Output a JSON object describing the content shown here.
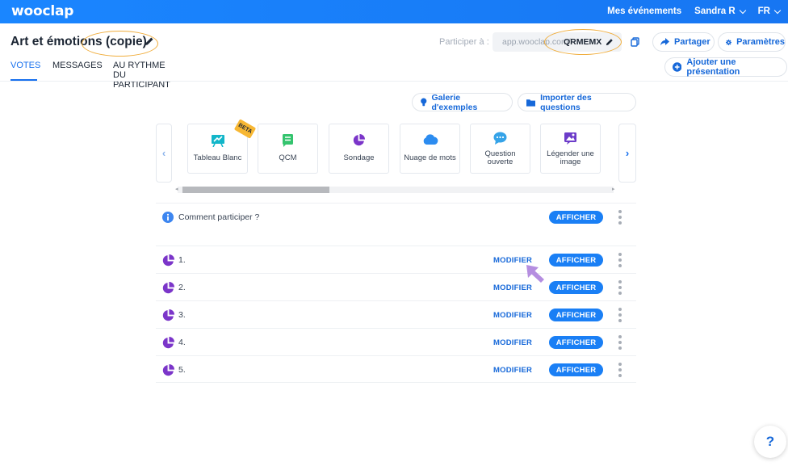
{
  "app": {
    "brand": "wooclap"
  },
  "topnav": {
    "events": "Mes événements",
    "user": "Sandra R",
    "lang": "FR"
  },
  "event": {
    "title": "Art et émotions (copie)"
  },
  "participate": {
    "label": "Participer à :",
    "url_base": "app.wooclap.com/",
    "code": "QRMEMX"
  },
  "actions": {
    "share": "Partager",
    "settings": "Paramètres",
    "add_presentation": "Ajouter une présentation"
  },
  "tabs": [
    {
      "label": "VOTES",
      "active": true
    },
    {
      "label": "MESSAGES",
      "active": false
    },
    {
      "label": "AU RYTHME DU PARTICIPANT",
      "active": false
    }
  ],
  "library": {
    "gallery": "Galerie d'exemples",
    "import": "Importer des questions"
  },
  "question_types": [
    {
      "label": "Tableau Blanc",
      "icon": "whiteboard-icon",
      "color": "#12b6c9"
    },
    {
      "label": "QCM",
      "icon": "mcq-icon",
      "color": "#34c46e"
    },
    {
      "label": "Sondage",
      "icon": "poll-icon",
      "color": "#7b35c9"
    },
    {
      "label": "Nuage de mots",
      "icon": "cloud-icon",
      "color": "#2c8cf0"
    },
    {
      "label": "Question ouverte",
      "icon": "chat-bubble-icon",
      "color": "#35a3e8"
    },
    {
      "label": "Légender une image",
      "icon": "image-label-icon",
      "color": "#6c3cc9"
    }
  ],
  "beta_badge": "BETA",
  "how_to": {
    "label": "Comment participer ?",
    "show": "AFFICHER"
  },
  "questions": [
    {
      "label": "1.",
      "edit": "MODIFIER",
      "show": "AFFICHER"
    },
    {
      "label": "2.",
      "edit": "MODIFIER",
      "show": "AFFICHER"
    },
    {
      "label": "3.",
      "edit": "MODIFIER",
      "show": "AFFICHER"
    },
    {
      "label": "4.",
      "edit": "MODIFIER",
      "show": "AFFICHER"
    },
    {
      "label": "5.",
      "edit": "MODIFIER",
      "show": "AFFICHER"
    }
  ],
  "help": "?",
  "colors": {
    "accent": "#1a7ff5",
    "highlight_oval": "#f0ad3c",
    "pointer_arrow": "#b58ee0"
  }
}
